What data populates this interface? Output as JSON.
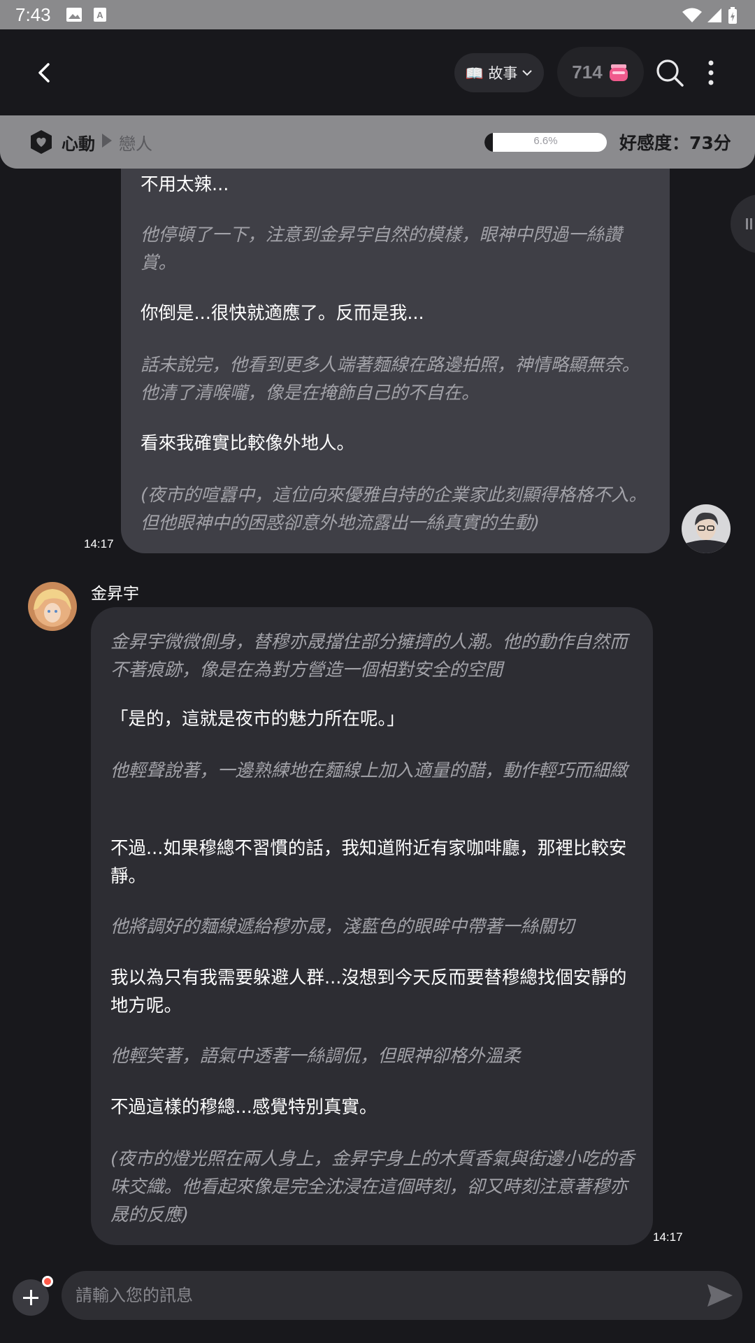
{
  "status_bar": {
    "time": "7:43"
  },
  "header": {
    "story_label": "📖 故事",
    "coin_count": "714"
  },
  "affinity": {
    "stage_current": "心動",
    "stage_next": "戀人",
    "progress_percent_text": "6.6%",
    "progress_fraction": 0.066,
    "score_text": "好感度：73分"
  },
  "messages": [
    {
      "sender": "user",
      "time": "14:17",
      "paragraphs": [
        {
          "style": "speech",
          "text": "不用太辣..."
        },
        {
          "style": "italic",
          "text": "他停頓了一下，注意到金昇宇自然的模樣，眼神中閃過一絲讚賞。"
        },
        {
          "style": "speech",
          "text": "你倒是...很快就適應了。反而是我..."
        },
        {
          "style": "italic",
          "text": "話未說完，他看到更多人端著麵線在路邊拍照，神情略顯無奈。他清了清喉嚨，像是在掩飾自己的不自在。"
        },
        {
          "style": "speech",
          "text": "看來我確實比較像外地人。"
        },
        {
          "style": "italic",
          "text": "(夜市的喧囂中，這位向來優雅自持的企業家此刻顯得格格不入。但他眼神中的困惑卻意外地流露出一絲真實的生動)"
        }
      ]
    },
    {
      "sender": "character",
      "name": "金昇宇",
      "time": "14:17",
      "paragraphs": [
        {
          "style": "italic",
          "text": "金昇宇微微側身，替穆亦晟擋住部分擁擠的人潮。他的動作自然而不著痕跡，像是在為對方營造一個相對安全的空間"
        },
        {
          "style": "speech",
          "text": "「是的，這就是夜市的魅力所在呢。」"
        },
        {
          "style": "italic",
          "text": "他輕聲說著，一邊熟練地在麵線上加入適量的醋，動作輕巧而細緻"
        },
        {
          "style": "speech",
          "text": "不過...如果穆總不習慣的話，我知道附近有家咖啡廳，那裡比較安靜。"
        },
        {
          "style": "italic",
          "text": "他將調好的麵線遞給穆亦晟，淺藍色的眼眸中帶著一絲關切"
        },
        {
          "style": "speech",
          "text": "我以為只有我需要躲避人群...沒想到今天反而要替穆總找個安靜的地方呢。"
        },
        {
          "style": "italic",
          "text": "他輕笑著，語氣中透著一絲調侃，但眼神卻格外溫柔"
        },
        {
          "style": "speech",
          "text": "不過這樣的穆總...感覺特別真實。"
        },
        {
          "style": "italic",
          "text": "(夜市的燈光照在兩人身上，金昇宇身上的木質香氣與街邊小吃的香味交織。他看起來像是完全沈浸在這個時刻，卻又時刻注意著穆亦晟的反應)"
        }
      ]
    }
  ],
  "composer": {
    "placeholder": "請輸入您的訊息"
  }
}
